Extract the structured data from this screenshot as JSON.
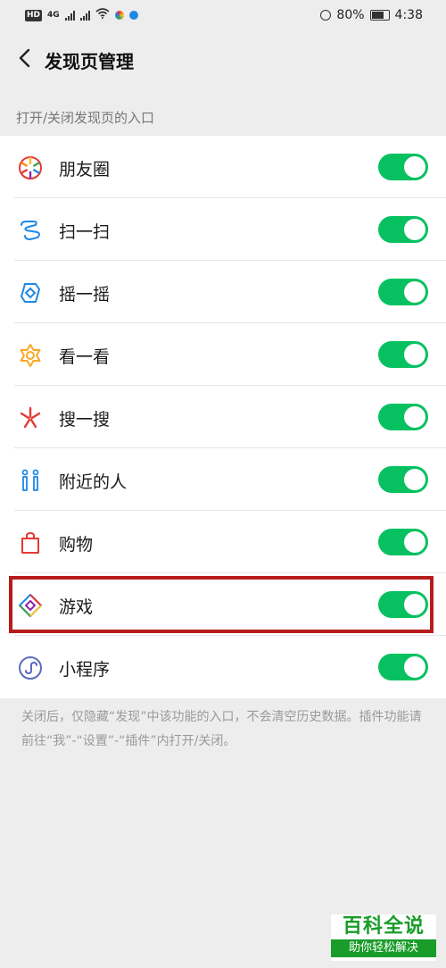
{
  "status_bar": {
    "hd": "HD",
    "network": "4G",
    "battery": "80%",
    "time": "4:38"
  },
  "header": {
    "back_icon": "chevron-left-icon",
    "title": "发现页管理"
  },
  "section_label": "打开/关闭发现页的入口",
  "items": [
    {
      "label": "朋友圈",
      "icon": "moments-icon",
      "enabled": true
    },
    {
      "label": "扫一扫",
      "icon": "scan-icon",
      "enabled": true
    },
    {
      "label": "摇一摇",
      "icon": "shake-icon",
      "enabled": true
    },
    {
      "label": "看一看",
      "icon": "top-stories-icon",
      "enabled": true
    },
    {
      "label": "搜一搜",
      "icon": "search-star-icon",
      "enabled": true
    },
    {
      "label": "附近的人",
      "icon": "people-nearby-icon",
      "enabled": true
    },
    {
      "label": "购物",
      "icon": "shopping-bag-icon",
      "enabled": true
    },
    {
      "label": "游戏",
      "icon": "games-icon",
      "enabled": true
    },
    {
      "label": "小程序",
      "icon": "mini-programs-icon",
      "enabled": true
    }
  ],
  "footnote": "关闭后，仅隐藏“发现”中该功能的入口，不会清空历史数据。插件功能请前往“我”-“设置”-“插件”内打开/关闭。",
  "watermark": {
    "main": "百科全说",
    "sub": "助你轻松解决"
  },
  "colors": {
    "toggle_on": "#07c160",
    "highlight": "#b71c1c"
  }
}
